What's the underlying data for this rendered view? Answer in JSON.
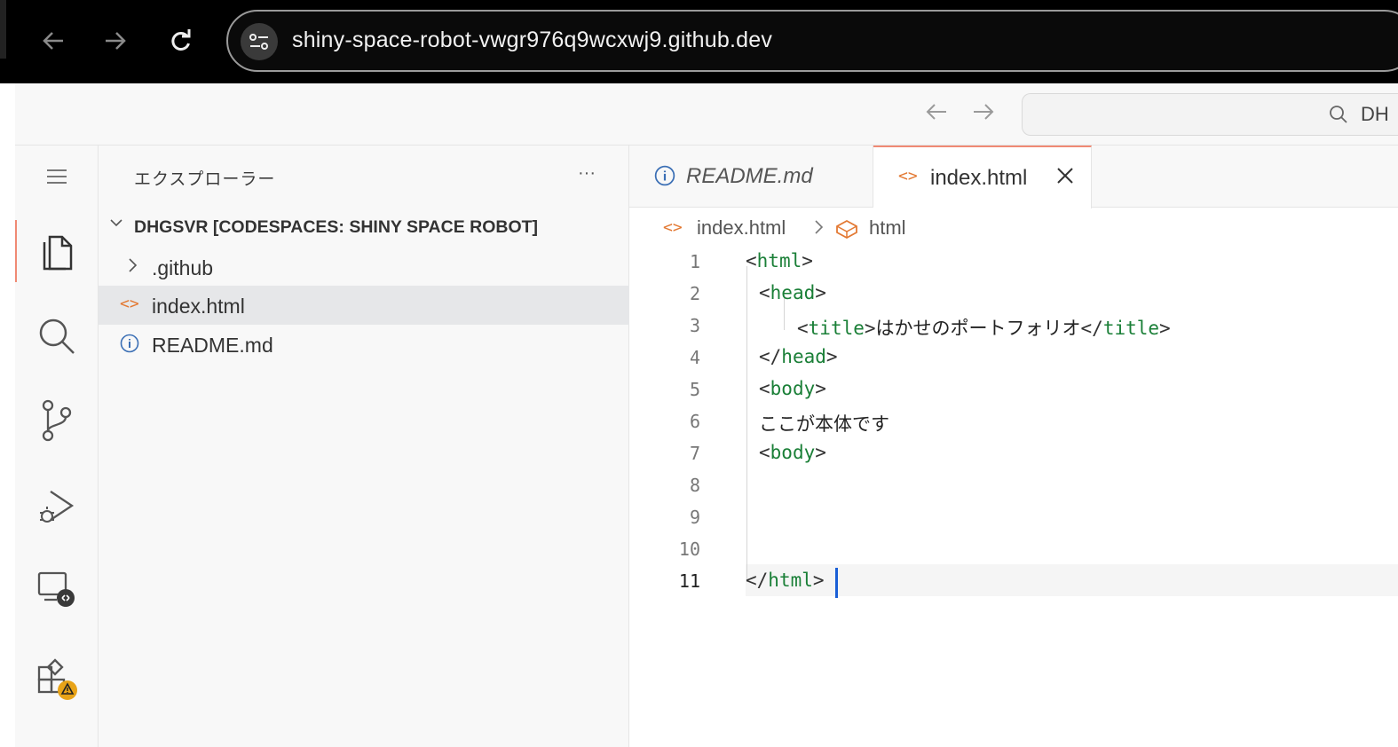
{
  "browser": {
    "url": "shiny-space-robot-vwgr976q9wcxwj9.github.dev"
  },
  "title_bar": {
    "command_center_text": "DH"
  },
  "sidebar": {
    "title": "エクスプローラー",
    "more": "···",
    "root_label": "DHGSVR [CODESPACES: SHINY SPACE ROBOT]",
    "items": [
      {
        "label": ".github",
        "icon": "chevron-right-icon"
      },
      {
        "label": "index.html",
        "icon": "html-file-icon"
      },
      {
        "label": "README.md",
        "icon": "info-icon"
      }
    ]
  },
  "editor": {
    "tabs": [
      {
        "label": "README.md",
        "icon": "info-icon",
        "active": false
      },
      {
        "label": "index.html",
        "icon": "html-file-icon",
        "active": true
      }
    ],
    "breadcrumb": [
      "index.html",
      "html"
    ],
    "line_numbers": [
      "1",
      "2",
      "3",
      "4",
      "5",
      "6",
      "7",
      "8",
      "9",
      "10",
      "11"
    ],
    "lines": [
      "<html>",
      " <head>",
      "    <title>はかせのポートフォリオ</title>",
      " </head>",
      " <body>",
      " ここが本体です",
      " <body>",
      "",
      "",
      "",
      "</html>"
    ],
    "current_line": "11"
  },
  "colors": {
    "accent": "#f08a74",
    "tag": "#1a7f37",
    "cursor": "#1a5fd6"
  }
}
